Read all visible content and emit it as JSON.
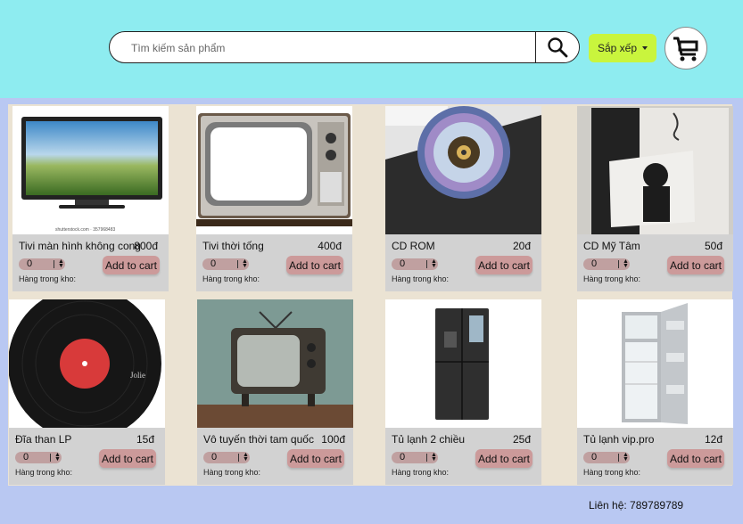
{
  "header": {
    "search_placeholder": "Tìm kiếm sản phẩm",
    "sort_label": "Sắp xếp",
    "bg": "#8eecf0",
    "sort_bg": "#c9f53d"
  },
  "products": [
    {
      "name": "Tivi màn hình không cong",
      "price": "800đ",
      "qty": "0",
      "add": "Add to cart",
      "stock": "Hàng trong kho:",
      "caption": "shutterstock.com · 357968483"
    },
    {
      "name": "Tivi thời tống",
      "price": "400đ",
      "qty": "0",
      "add": "Add to cart",
      "stock": "Hàng trong kho:"
    },
    {
      "name": "CD ROM",
      "price": "20đ",
      "qty": "0",
      "add": "Add to cart",
      "stock": "Hàng trong kho:"
    },
    {
      "name": "CD Mỹ Tâm",
      "price": "50đ",
      "qty": "0",
      "add": "Add to cart",
      "stock": "Hàng trong kho:"
    },
    {
      "name": "Đĩa than LP",
      "price": "15đ",
      "qty": "0",
      "add": "Add to cart",
      "stock": "Hàng trong kho:"
    },
    {
      "name": "Vô tuyến thời tam quốc",
      "price": "100đ",
      "qty": "0",
      "add": "Add to cart",
      "stock": "Hàng trong kho:"
    },
    {
      "name": "Tủ lạnh 2 chiều",
      "price": "25đ",
      "qty": "0",
      "add": "Add to cart",
      "stock": "Hàng trong kho:"
    },
    {
      "name": "Tủ lạnh  vip.pro",
      "price": "12đ",
      "qty": "0",
      "add": "Add to cart",
      "stock": "Hàng trong kho:"
    }
  ],
  "footer": {
    "contact": "Liên hệ: 789789789"
  }
}
